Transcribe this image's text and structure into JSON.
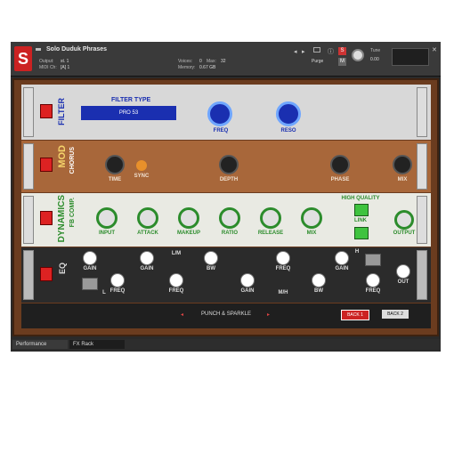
{
  "header": {
    "instrument": "Solo Duduk Phrases",
    "output_label": "Output:",
    "output_value": "st. 1",
    "midi_label": "MIDI Ch:",
    "midi_value": "[A] 1",
    "voices_label": "Voices:",
    "voices_value": "0",
    "max_label": "Max:",
    "max_value": "32",
    "memory_label": "Memory:",
    "memory_value": "0.67 GB",
    "purge_label": "Purge",
    "tune_label": "Tune",
    "tune_value": "0.00",
    "s_button": "S",
    "m_button": "M"
  },
  "filter": {
    "side_label": "FILTER",
    "type_label": "FILTER TYPE",
    "type_value": "PRO 53",
    "knob_freq": "FREQ",
    "knob_reso": "RESO"
  },
  "chorus": {
    "side_label_1": "MOD",
    "side_label_2": "CHORUS",
    "time": "TIME",
    "sync": "SYNC",
    "depth": "DEPTH",
    "phase": "PHASE",
    "mix": "MIX"
  },
  "dynamics": {
    "side_label_1": "DYNAMICS",
    "side_label_2": "FB COMP.",
    "input": "INPUT",
    "attack": "ATTACK",
    "makeup": "MAKEUP",
    "ratio": "RATIO",
    "release": "RELEASE",
    "mix": "MIX",
    "high_quality": "HIGH QUALITY",
    "link": "LINK",
    "output": "OUTPUT"
  },
  "eq": {
    "side_label": "EQ",
    "gain": "GAIN",
    "freq": "FREQ",
    "bw": "BW",
    "lm": "L/M",
    "mh": "M/H",
    "l": "L",
    "h": "H",
    "out": "OUT"
  },
  "footer": {
    "preset": "PUNCH & SPARKLE",
    "back1": "BACK 1",
    "back2": "BACK 2"
  },
  "tabs": [
    "Performance",
    "FX Rack"
  ],
  "colors": {
    "accent_red": "#c22222",
    "filter_blue": "#1a2fb0",
    "chorus_wood": "#a8673a",
    "dynamics_green": "#2c8c2c"
  }
}
